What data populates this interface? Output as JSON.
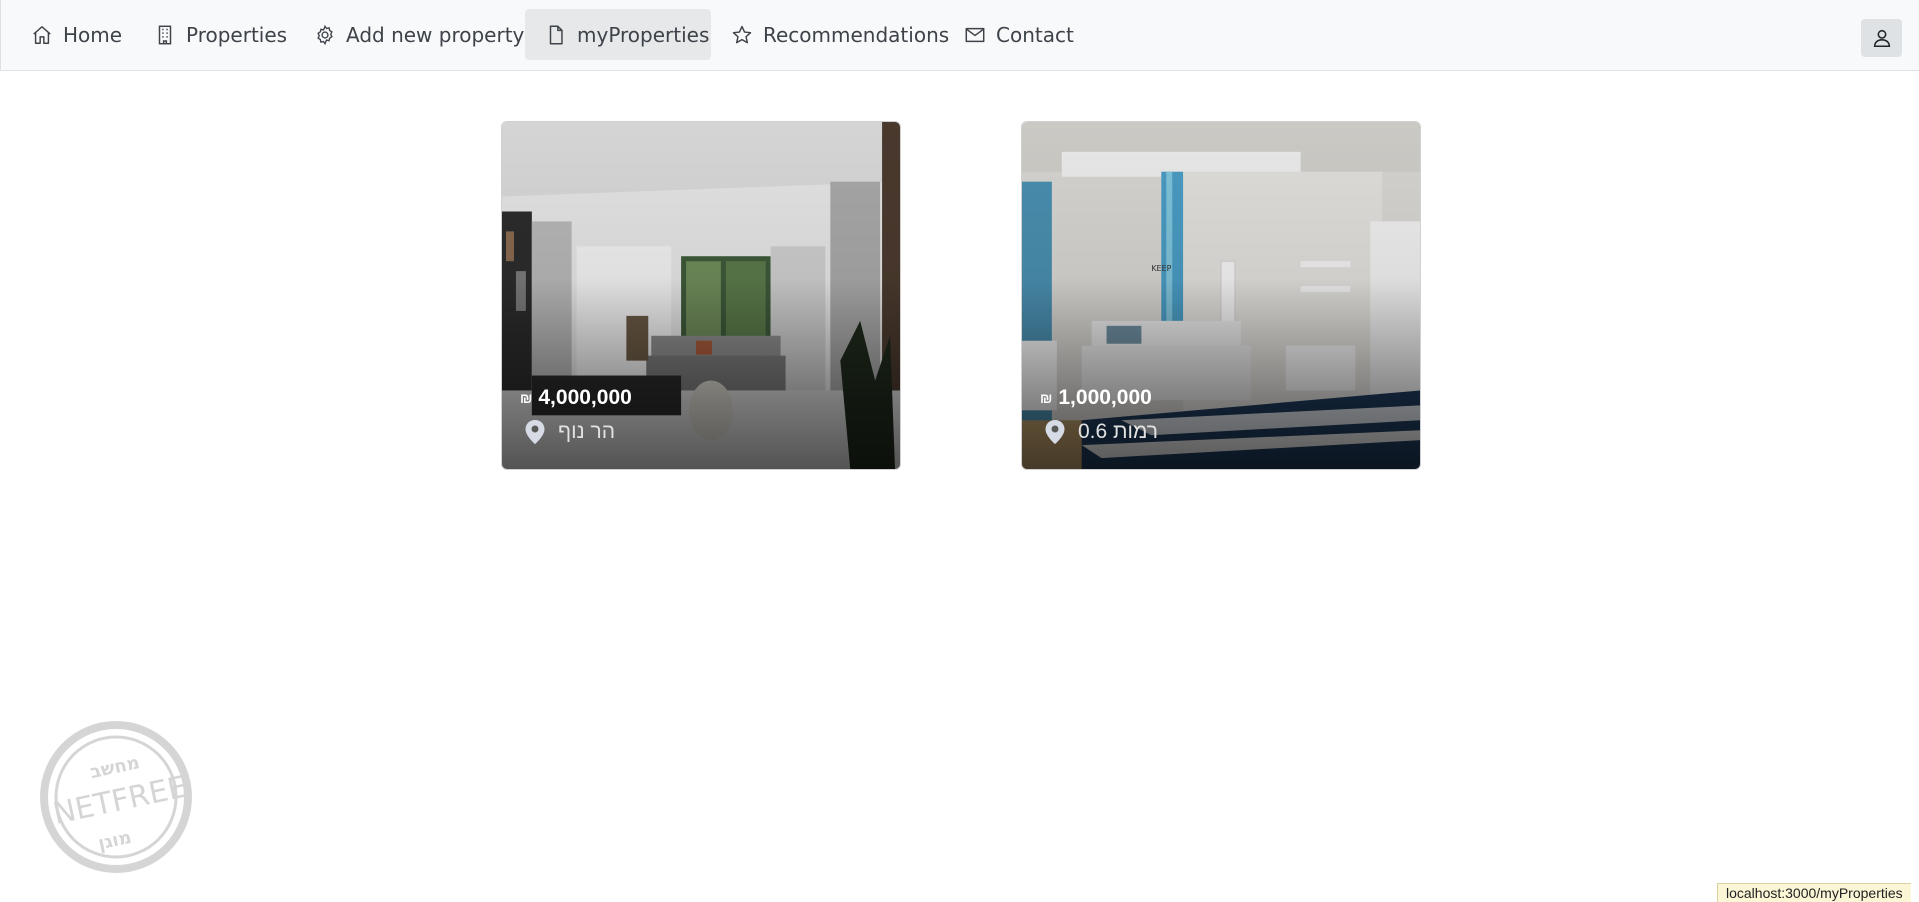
{
  "nav": {
    "items": [
      {
        "label": "Home",
        "icon": "home-icon"
      },
      {
        "label": "Properties",
        "icon": "building-icon"
      },
      {
        "label": "Add new property",
        "icon": "gear-icon"
      },
      {
        "label": "myProperties",
        "icon": "file-icon",
        "active": true
      },
      {
        "label": "Recommendations",
        "icon": "star-icon"
      },
      {
        "label": "Contact",
        "icon": "envelope-icon"
      }
    ],
    "user_icon": "user-icon"
  },
  "properties": [
    {
      "currency": "₪",
      "price": "4,000,000",
      "location": "הר נוף",
      "image": "living-room-photo"
    },
    {
      "currency": "₪",
      "price": "1,000,000",
      "location": "רמות 0.6",
      "image": "bedroom-photo"
    }
  ],
  "watermark_text": [
    "מחשב",
    "NETFREE",
    "מוגן"
  ],
  "status_bar": {
    "url": "localhost:3000/myProperties"
  },
  "colors": {
    "navbar_bg": "#f8f9fa",
    "active_tab_bg": "#e6e8ea",
    "user_button_bg": "#dfe2e5"
  }
}
